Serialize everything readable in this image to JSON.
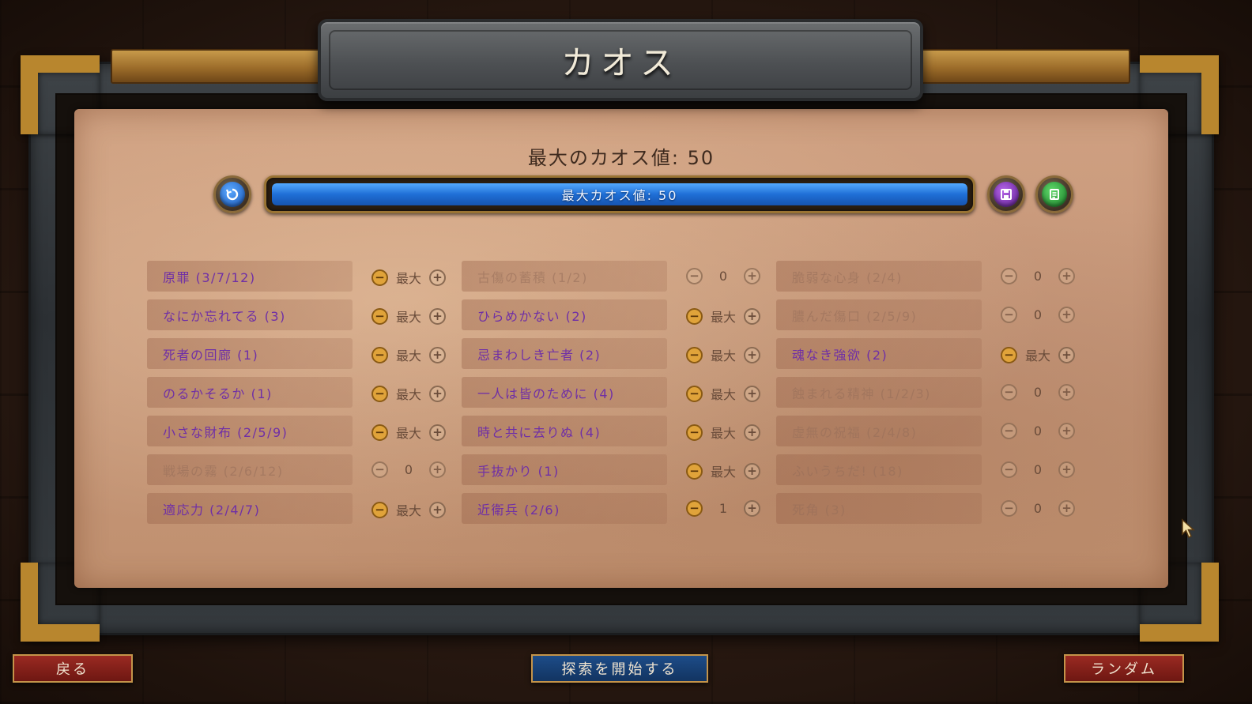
{
  "title": "カオス",
  "max_chaos_heading": "最大のカオス値: 50",
  "progress": {
    "label": "最大カオス値: 50",
    "fill_fraction": 1.0,
    "fill_color": "#1f6fd6"
  },
  "icons": {
    "reset": "refresh-icon",
    "save": "floppy-disk-icon",
    "list": "document-list-icon"
  },
  "colors": {
    "active_label": "#6f2fa6",
    "minus_active": "#e0a33a",
    "parchment": "#c6977a"
  },
  "modifiers": [
    [
      {
        "label": "原罪 (3/7/12)",
        "value": "最大",
        "enabled": true
      },
      {
        "label": "なにか忘れてる (3)",
        "value": "最大",
        "enabled": true
      },
      {
        "label": "死者の回廊 (1)",
        "value": "最大",
        "enabled": true
      },
      {
        "label": "のるかそるか (1)",
        "value": "最大",
        "enabled": true
      },
      {
        "label": "小さな財布 (2/5/9)",
        "value": "最大",
        "enabled": true
      },
      {
        "label": "戦場の霧 (2/6/12)",
        "value": "0",
        "enabled": false
      },
      {
        "label": "適応力 (2/4/7)",
        "value": "最大",
        "enabled": true
      }
    ],
    [
      {
        "label": "古傷の蓄積 (1/2)",
        "value": "0",
        "enabled": false
      },
      {
        "label": "ひらめかない (2)",
        "value": "最大",
        "enabled": true
      },
      {
        "label": "忌まわしき亡者 (2)",
        "value": "最大",
        "enabled": true
      },
      {
        "label": "一人は皆のために (4)",
        "value": "最大",
        "enabled": true
      },
      {
        "label": "時と共に去りぬ (4)",
        "value": "最大",
        "enabled": true
      },
      {
        "label": "手抜かり (1)",
        "value": "最大",
        "enabled": true
      },
      {
        "label": "近衛兵 (2/6)",
        "value": "1",
        "enabled": true
      }
    ],
    [
      {
        "label": "脆弱な心身 (2/4)",
        "value": "0",
        "enabled": false
      },
      {
        "label": "膿んだ傷口 (2/5/9)",
        "value": "0",
        "enabled": false
      },
      {
        "label": "魂なき強欲 (2)",
        "value": "最大",
        "enabled": true
      },
      {
        "label": "蝕まれる精神 (1/2/3)",
        "value": "0",
        "enabled": false
      },
      {
        "label": "虚無の祝福 (2/4/8)",
        "value": "0",
        "enabled": false
      },
      {
        "label": "ふいうちだ! (18)",
        "value": "0",
        "enabled": false
      },
      {
        "label": "死角 (3)",
        "value": "0",
        "enabled": false
      }
    ]
  ],
  "buttons": {
    "back": "戻る",
    "start": "探索を開始する",
    "random": "ランダム"
  }
}
